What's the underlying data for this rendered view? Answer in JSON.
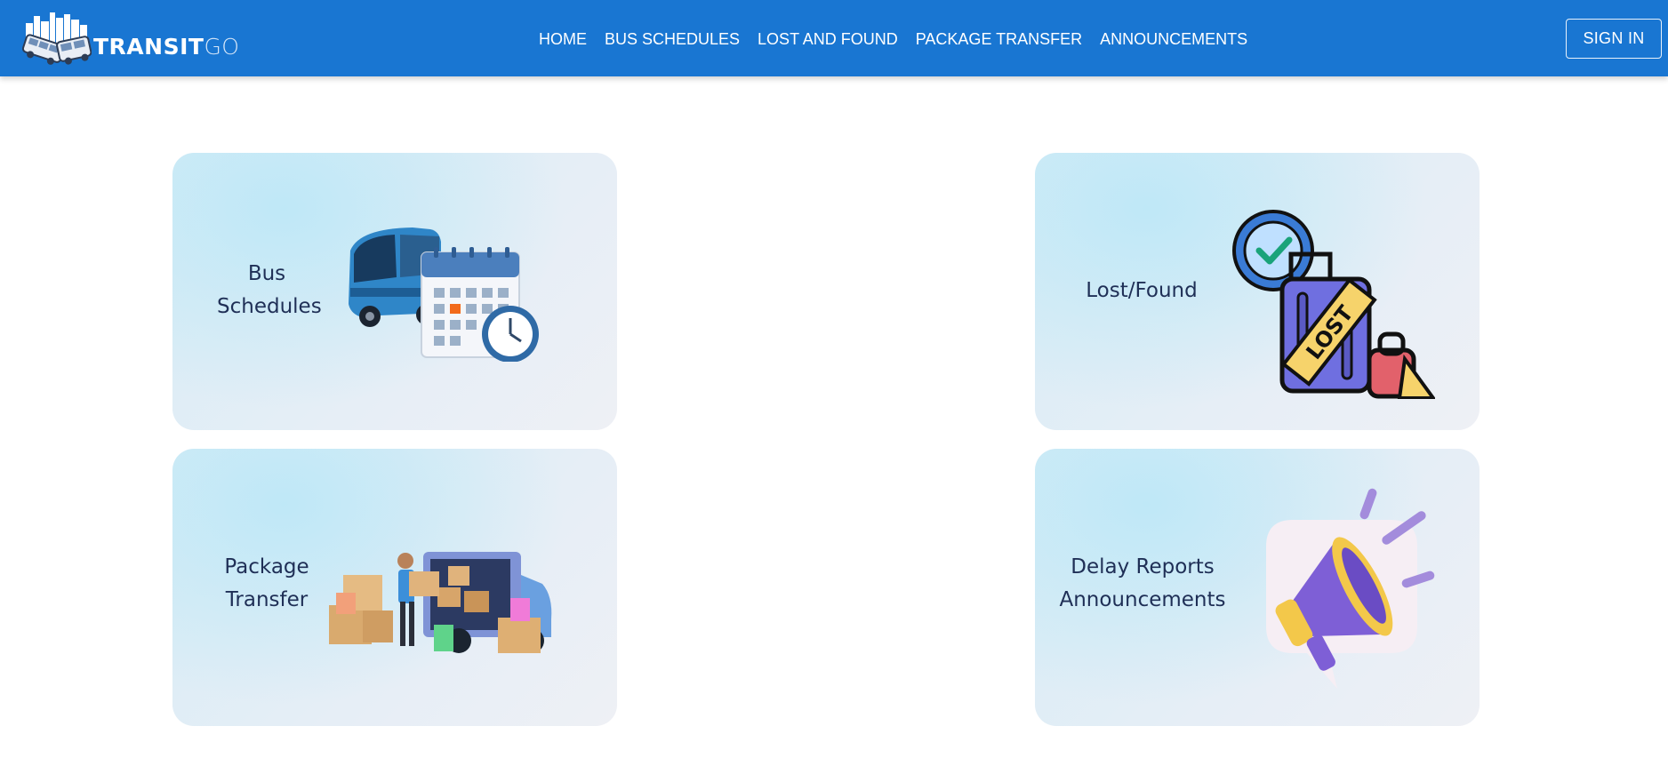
{
  "brand": {
    "bold": "TRANSIT",
    "light": "GO"
  },
  "nav": {
    "links": [
      "HOME",
      "BUS SCHEDULES",
      "LOST AND FOUND",
      "PACKAGE TRANSFER",
      "ANNOUNCEMENTS"
    ],
    "signin_label": "SIGN IN"
  },
  "cards": [
    {
      "label": "Bus\nSchedules",
      "icon": "bus-schedule-illustration"
    },
    {
      "label": "Lost/Found",
      "icon": "lost-luggage-illustration"
    },
    {
      "label": "Package\nTransfer",
      "icon": "package-delivery-illustration"
    },
    {
      "label": "Delay Reports\nAnnouncements",
      "icon": "megaphone-illustration"
    }
  ],
  "colors": {
    "navbar": "#1976d2",
    "card_text": "#1f2f56"
  },
  "illustration_text": {
    "lost_tag": "LOST"
  }
}
